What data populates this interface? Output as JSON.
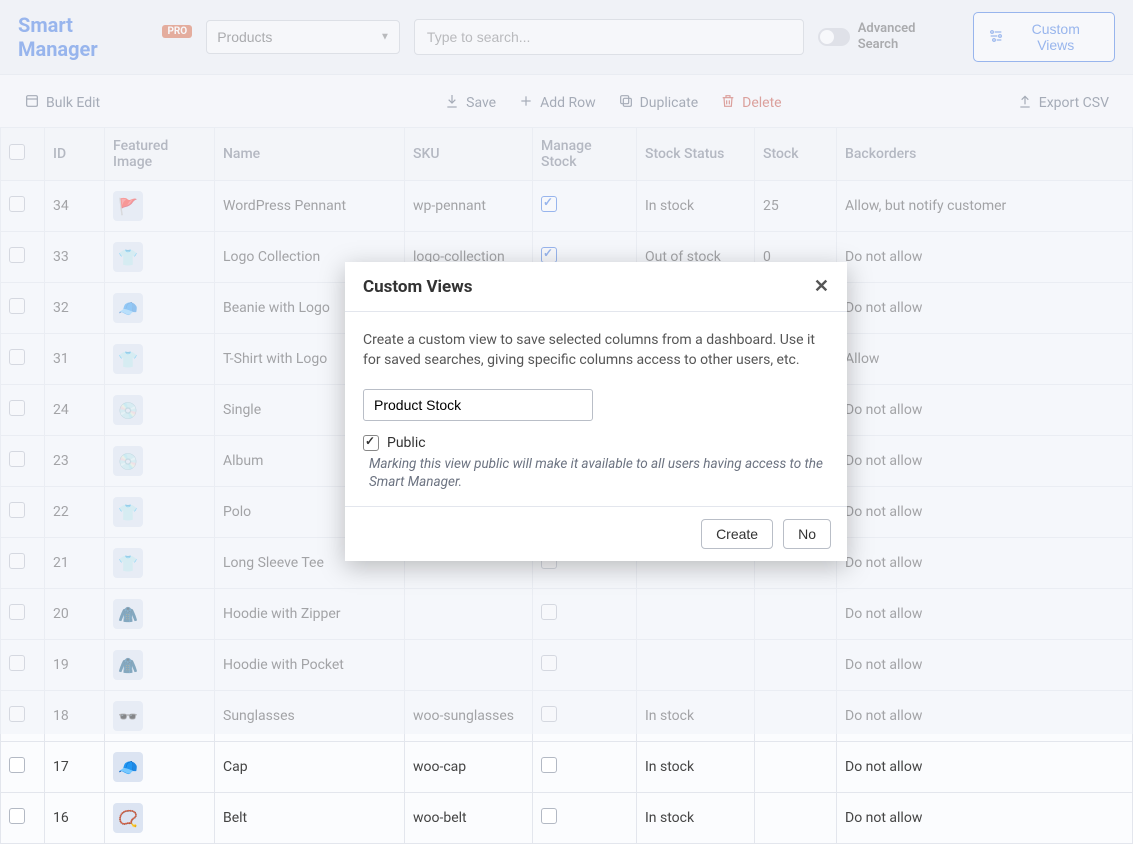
{
  "header": {
    "logo_main": "Smart Manager",
    "logo_badge": "PRO",
    "dashboard_select": "Products",
    "search_placeholder": "Type to search...",
    "advanced_search": "Advanced Search",
    "custom_views_btn": "Custom Views"
  },
  "toolbar": {
    "bulk_edit": "Bulk Edit",
    "save": "Save",
    "add_row": "Add Row",
    "duplicate": "Duplicate",
    "delete": "Delete",
    "export_csv": "Export CSV"
  },
  "columns": {
    "id": "ID",
    "featured_image": "Featured Image",
    "name": "Name",
    "sku": "SKU",
    "manage_stock": "Manage Stock",
    "stock_status": "Stock Status",
    "stock": "Stock",
    "backorders": "Backorders"
  },
  "rows": [
    {
      "id": "34",
      "icon": "🚩",
      "name": "WordPress Pennant",
      "sku": "wp-pennant",
      "manage": true,
      "status": "In stock",
      "status_cls": "",
      "stock": "25",
      "back": "Allow, but notify customer",
      "back_cls": ""
    },
    {
      "id": "33",
      "icon": "👕",
      "name": "Logo Collection",
      "sku": "logo-collection",
      "manage": true,
      "status": "Out of stock",
      "status_cls": "out-stock",
      "stock": "0",
      "back": "Do not allow",
      "back_cls": "do-not-allow"
    },
    {
      "id": "32",
      "icon": "🧢",
      "name": "Beanie with Logo",
      "sku": "",
      "manage": false,
      "status": "",
      "status_cls": "",
      "stock": "",
      "back": "Do not allow",
      "back_cls": "do-not-allow"
    },
    {
      "id": "31",
      "icon": "👕",
      "name": "T-Shirt with Logo",
      "sku": "",
      "manage": false,
      "status": "",
      "status_cls": "",
      "stock": "",
      "back": "Allow",
      "back_cls": ""
    },
    {
      "id": "24",
      "icon": "💿",
      "name": "Single",
      "sku": "",
      "manage": false,
      "status": "",
      "status_cls": "",
      "stock": "",
      "back": "Do not allow",
      "back_cls": "do-not-allow"
    },
    {
      "id": "23",
      "icon": "💿",
      "name": "Album",
      "sku": "",
      "manage": false,
      "status": "",
      "status_cls": "",
      "stock": "",
      "back": "Do not allow",
      "back_cls": "do-not-allow"
    },
    {
      "id": "22",
      "icon": "👕",
      "name": "Polo",
      "sku": "",
      "manage": false,
      "status": "",
      "status_cls": "",
      "stock": "",
      "back": "Do not allow",
      "back_cls": "do-not-allow"
    },
    {
      "id": "21",
      "icon": "👕",
      "name": "Long Sleeve Tee",
      "sku": "",
      "manage": false,
      "status": "",
      "status_cls": "",
      "stock": "",
      "back": "Do not allow",
      "back_cls": "do-not-allow"
    },
    {
      "id": "20",
      "icon": "🧥",
      "name": "Hoodie with Zipper",
      "sku": "",
      "manage": false,
      "status": "",
      "status_cls": "",
      "stock": "",
      "back": "Do not allow",
      "back_cls": "do-not-allow"
    },
    {
      "id": "19",
      "icon": "🧥",
      "name": "Hoodie with Pocket",
      "sku": "",
      "manage": false,
      "status": "",
      "status_cls": "",
      "stock": "",
      "back": "Do not allow",
      "back_cls": "do-not-allow"
    },
    {
      "id": "18",
      "icon": "🕶️",
      "name": "Sunglasses",
      "sku": "woo-sunglasses",
      "manage": false,
      "status": "In stock",
      "status_cls": "",
      "stock": "",
      "back": "Do not allow",
      "back_cls": "do-not-allow"
    },
    {
      "id": "17",
      "icon": "🧢",
      "name": "Cap",
      "sku": "woo-cap",
      "manage": false,
      "status": "In stock",
      "status_cls": "",
      "stock": "",
      "back": "Do not allow",
      "back_cls": "do-not-allow"
    },
    {
      "id": "16",
      "icon": "📿",
      "name": "Belt",
      "sku": "woo-belt",
      "manage": false,
      "status": "In stock",
      "status_cls": "",
      "stock": "",
      "back": "Do not allow",
      "back_cls": "do-not-allow"
    }
  ],
  "modal": {
    "title": "Custom Views",
    "desc": "Create a custom view to save selected columns from a dashboard. Use it for saved searches, giving specific columns access to other users, etc.",
    "name_value": "Product Stock",
    "public_label": "Public",
    "public_hint": "Marking this view public will make it available to all users having access to the Smart Manager.",
    "create": "Create",
    "no": "No"
  }
}
